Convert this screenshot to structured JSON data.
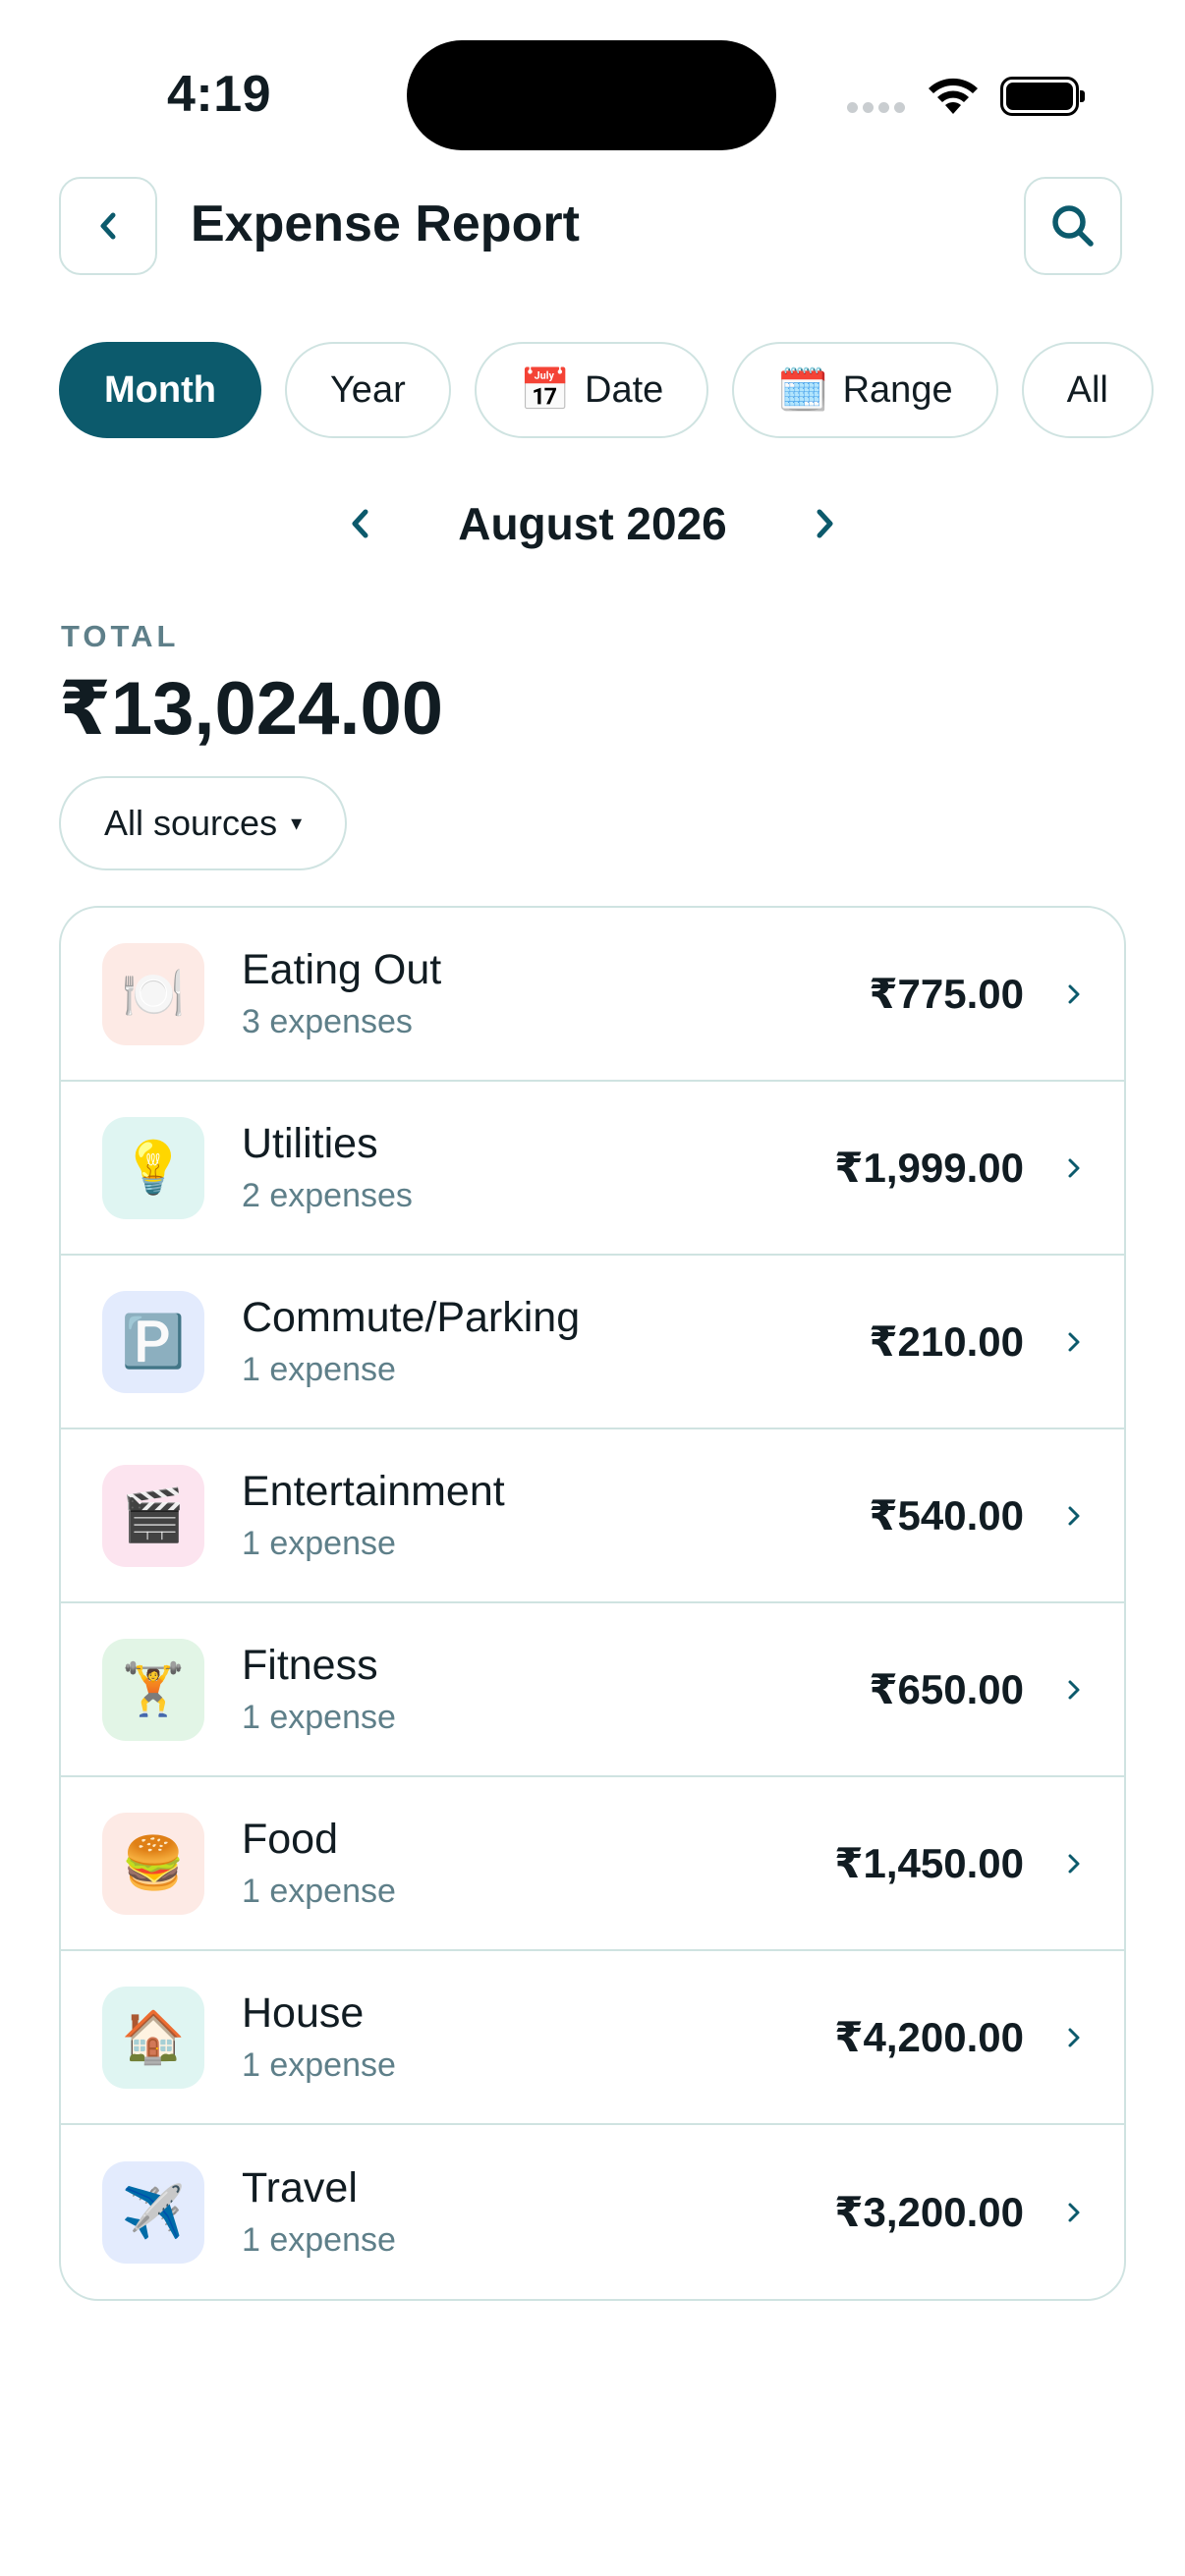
{
  "status_bar": {
    "time": "4:19"
  },
  "header": {
    "title": "Expense Report"
  },
  "filters": [
    {
      "label": "Month",
      "emoji": "",
      "active": true
    },
    {
      "label": "Year",
      "emoji": "",
      "active": false
    },
    {
      "label": "Date",
      "emoji": "📅",
      "active": false
    },
    {
      "label": "Range",
      "emoji": "🗓️",
      "active": false
    },
    {
      "label": "All",
      "emoji": "",
      "active": false
    }
  ],
  "period": {
    "label": "August 2026"
  },
  "total": {
    "label": "TOTAL",
    "value": "₹13,024.00"
  },
  "source_filter": {
    "label": "All sources",
    "caret": "▾"
  },
  "categories": [
    {
      "name": "Eating Out",
      "count": "3 expenses",
      "amount": "₹775.00",
      "emoji": "🍽️",
      "bg": "#fdeae5"
    },
    {
      "name": "Utilities",
      "count": "2 expenses",
      "amount": "₹1,999.00",
      "emoji": "💡",
      "bg": "#dff5f2"
    },
    {
      "name": "Commute/Parking",
      "count": "1 expense",
      "amount": "₹210.00",
      "emoji": "🅿️",
      "bg": "#e3ebfd"
    },
    {
      "name": "Entertainment",
      "count": "1 expense",
      "amount": "₹540.00",
      "emoji": "🎬",
      "bg": "#fce4ef"
    },
    {
      "name": "Fitness",
      "count": "1 expense",
      "amount": "₹650.00",
      "emoji": "🏋️",
      "bg": "#e2f5e6"
    },
    {
      "name": "Food",
      "count": "1 expense",
      "amount": "₹1,450.00",
      "emoji": "🍔",
      "bg": "#fdeae5"
    },
    {
      "name": "House",
      "count": "1 expense",
      "amount": "₹4,200.00",
      "emoji": "🏠",
      "bg": "#dff5f2"
    },
    {
      "name": "Travel",
      "count": "1 expense",
      "amount": "₹3,200.00",
      "emoji": "✈️",
      "bg": "#e3ebfd"
    }
  ],
  "colors": {
    "accent": "#0c5a6c",
    "border": "#cfe3e1",
    "muted": "#5e7f89",
    "text": "#111c22"
  }
}
